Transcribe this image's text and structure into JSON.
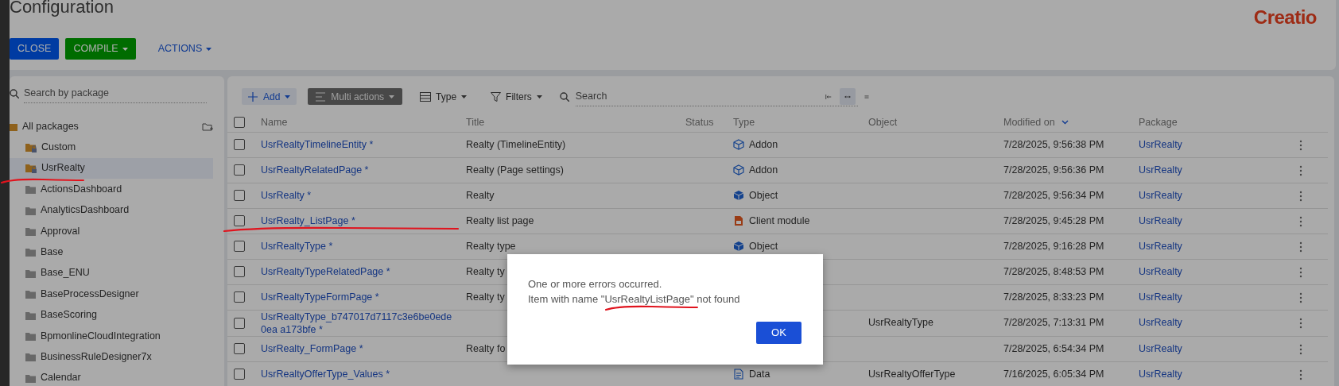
{
  "page": {
    "title": "Configuration",
    "logo": "Creatio"
  },
  "header_buttons": [
    {
      "label": "CLOSE",
      "kind": "primary",
      "dropdown": false
    },
    {
      "label": "COMPILE",
      "kind": "success",
      "dropdown": true
    },
    {
      "label": "ACTIONS",
      "kind": "link",
      "dropdown": true
    }
  ],
  "sidebar": {
    "search": {
      "placeholder": "Search by package"
    },
    "root": {
      "label": "All packages",
      "children": [
        {
          "label": "Custom",
          "kind": "locked",
          "selected": false,
          "marked": false
        },
        {
          "label": "UsrRealty",
          "kind": "locked",
          "selected": true,
          "marked": true
        },
        {
          "label": "ActionsDashboard",
          "kind": "folder",
          "selected": false,
          "marked": false
        },
        {
          "label": "AnalyticsDashboard",
          "kind": "folder",
          "selected": false,
          "marked": false
        },
        {
          "label": "Approval",
          "kind": "folder",
          "selected": false,
          "marked": false
        },
        {
          "label": "Base",
          "kind": "folder",
          "selected": false,
          "marked": false
        },
        {
          "label": "Base_ENU",
          "kind": "folder",
          "selected": false,
          "marked": false
        },
        {
          "label": "BaseProcessDesigner",
          "kind": "folder",
          "selected": false,
          "marked": false
        },
        {
          "label": "BaseScoring",
          "kind": "folder",
          "selected": false,
          "marked": false
        },
        {
          "label": "BpmonlineCloudIntegration",
          "kind": "folder",
          "selected": false,
          "marked": false
        },
        {
          "label": "BusinessRuleDesigner7x",
          "kind": "folder",
          "selected": false,
          "marked": false
        },
        {
          "label": "Calendar",
          "kind": "folder",
          "selected": false,
          "marked": false
        }
      ]
    }
  },
  "toolbar": {
    "buttons": [
      {
        "label": "Add",
        "kind": "add"
      },
      {
        "label": "Multi actions",
        "kind": "multi"
      },
      {
        "label": "Type",
        "kind": "type"
      },
      {
        "label": "Filters",
        "kind": "filter"
      }
    ],
    "search": {
      "placeholder": "Search"
    },
    "view_modes": [
      {
        "kind": "collapse",
        "selected": false
      },
      {
        "kind": "fit",
        "selected": true
      },
      {
        "kind": "rows",
        "selected": false
      }
    ]
  },
  "table": {
    "all_checked": false,
    "columns": [
      {
        "label": "Name",
        "sorted": false
      },
      {
        "label": "Title",
        "sorted": false
      },
      {
        "label": "Status",
        "sorted": false
      },
      {
        "label": "Type",
        "sorted": false
      },
      {
        "label": "Object",
        "sorted": false
      },
      {
        "label": "Modified on",
        "sorted": true
      },
      {
        "label": "Package",
        "sorted": false
      }
    ],
    "rows": [
      {
        "checked": false,
        "marked": false,
        "name": "UsrRealtyTimelineEntity *",
        "title": "Realty (TimelineEntity)",
        "type": {
          "kind": "addon",
          "label": "Addon"
        },
        "modified": "7/28/2025, 9:56:38 PM",
        "package": "UsrRealty"
      },
      {
        "checked": false,
        "marked": false,
        "name": "UsrRealtyRelatedPage *",
        "title": "Realty (Page settings)",
        "type": {
          "kind": "addon",
          "label": "Addon"
        },
        "modified": "7/28/2025, 9:56:36 PM",
        "package": "UsrRealty"
      },
      {
        "checked": false,
        "marked": false,
        "name": "UsrRealty *",
        "title": "Realty",
        "type": {
          "kind": "object",
          "label": "Object"
        },
        "modified": "7/28/2025, 9:56:34 PM",
        "package": "UsrRealty"
      },
      {
        "checked": false,
        "marked": true,
        "name": "UsrRealty_ListPage *",
        "title": "Realty list page",
        "type": {
          "kind": "client_module",
          "label": "Client module"
        },
        "modified": "7/28/2025, 9:45:28 PM",
        "package": "UsrRealty"
      },
      {
        "checked": false,
        "marked": false,
        "name": "UsrRealtyType *",
        "title": "Realty type",
        "type": {
          "kind": "object",
          "label": "Object"
        },
        "modified": "7/28/2025, 9:16:28 PM",
        "package": "UsrRealty"
      },
      {
        "checked": false,
        "marked": false,
        "name": "UsrRealtyTypeRelatedPage *",
        "title": "Realty ty",
        "modified": "7/28/2025, 8:48:53 PM",
        "package": "UsrRealty"
      },
      {
        "checked": false,
        "marked": false,
        "name": "UsrRealtyTypeFormPage *",
        "title": "Realty ty",
        "modified": "7/28/2025, 8:33:23 PM",
        "package": "UsrRealty"
      },
      {
        "checked": false,
        "marked": false,
        "name": "UsrRealtyType_b747017d7117c3e6be0ede0ea a173bfe *",
        "object": "UsrRealtyType",
        "modified": "7/28/2025, 7:13:31 PM",
        "package": "UsrRealty"
      },
      {
        "checked": false,
        "marked": false,
        "name": "UsrRealty_FormPage *",
        "title": "Realty fo",
        "modified": "7/28/2025, 6:54:34 PM",
        "package": "UsrRealty"
      },
      {
        "checked": false,
        "marked": false,
        "name": "UsrRealtyOfferType_Values *",
        "type": {
          "kind": "data",
          "label": "Data"
        },
        "object": "UsrRealtyOfferType",
        "modified": "7/16/2025, 6:05:34 PM",
        "package": "UsrRealty"
      }
    ]
  },
  "dialog": {
    "line": "One or more errors occurred.",
    "message": {
      "before": "Item with name ",
      "marked": "\"UsrRealtyListPage\"",
      "after": " not found"
    },
    "button": "OK"
  }
}
